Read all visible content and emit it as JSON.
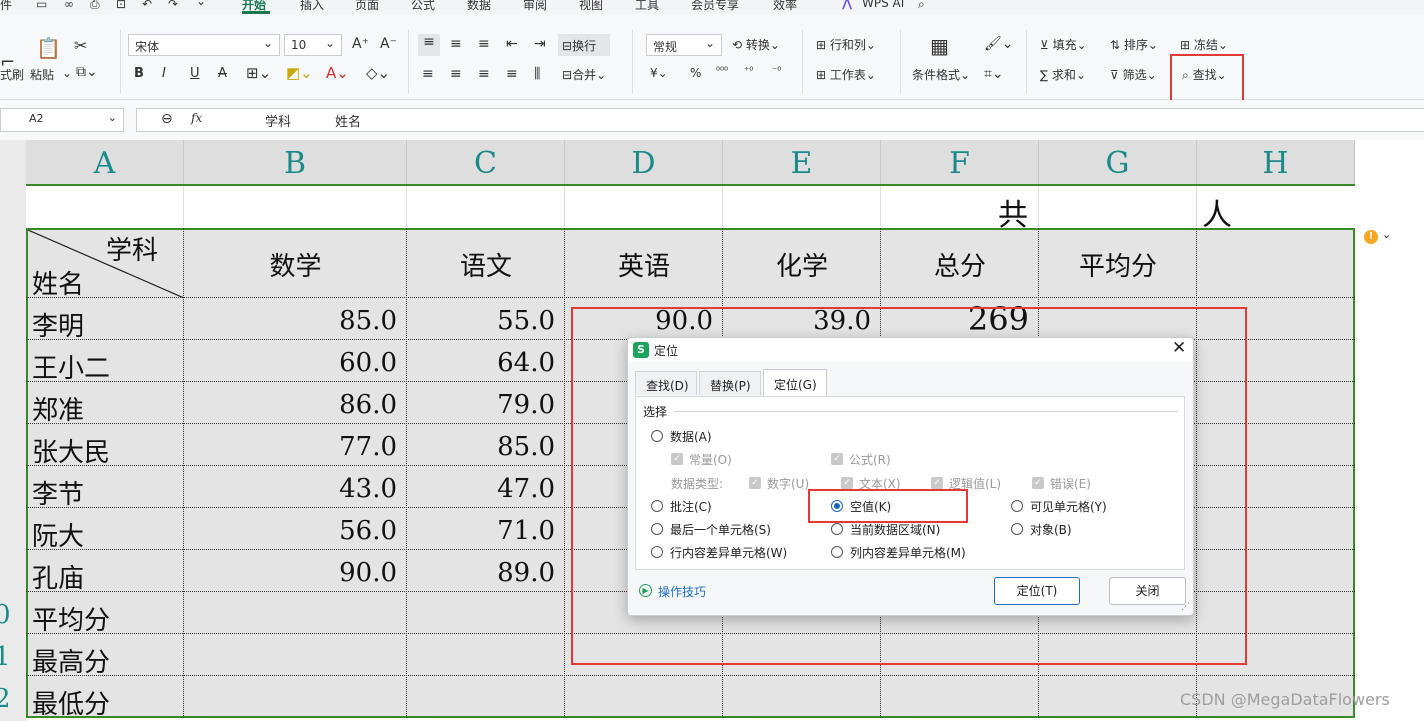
{
  "menu": {
    "items": [
      "件",
      "开始",
      "插入",
      "页面",
      "公式",
      "数据",
      "审阅",
      "视图",
      "工具",
      "会员专享",
      "效率"
    ],
    "wps_ai": "WPS AI"
  },
  "ribbon": {
    "format_painter": "式刷",
    "paste": "粘贴",
    "font_name": "宋体",
    "font_size": "10",
    "wrap": "换行",
    "number_format": "常规",
    "convert": "转换",
    "rows_cols": "行和列",
    "worksheet": "工作表",
    "cond_format": "条件格式",
    "merge": "合并",
    "fill": "填充",
    "sort": "排序",
    "freeze": "冻结",
    "sum": "求和",
    "filter": "筛选",
    "find": "查找",
    "currency": "¥",
    "percent": "%"
  },
  "formula_bar": {
    "cell_ref": "A2",
    "fx": "fx",
    "content_1": "学科",
    "content_2": "姓名"
  },
  "sheet": {
    "col_headers": [
      "A",
      "B",
      "C",
      "D",
      "E",
      "F",
      "G",
      "H"
    ],
    "row1": {
      "f": "共",
      "h": "人"
    },
    "header_row": {
      "diag_top": "学科",
      "diag_bottom": "姓名",
      "cols": [
        "数学",
        "语文",
        "英语",
        "化学",
        "总分",
        "平均分"
      ]
    },
    "rows": [
      {
        "name": "李明",
        "math": "85.0",
        "chinese": "55.0",
        "english": "90.0",
        "chem": "39.0",
        "total": "269"
      },
      {
        "name": "王小二",
        "math": "60.0",
        "chinese": "64.0"
      },
      {
        "name": "郑准",
        "math": "86.0",
        "chinese": "79.0"
      },
      {
        "name": "张大民",
        "math": "77.0",
        "chinese": "85.0"
      },
      {
        "name": "李节",
        "math": "43.0",
        "chinese": "47.0"
      },
      {
        "name": "阮大",
        "math": "56.0",
        "chinese": "71.0"
      },
      {
        "name": "孔庙",
        "math": "90.0",
        "chinese": "89.0"
      },
      {
        "name": "平均分"
      },
      {
        "name": "最高分"
      },
      {
        "name": "最低分"
      }
    ],
    "row_numbers": [
      "0",
      "1",
      "2"
    ]
  },
  "dialog": {
    "title": "定位",
    "tabs": [
      "查找(D)",
      "替换(P)",
      "定位(G)"
    ],
    "group": "选择",
    "opt_data": "数据(A)",
    "opt_const": "常量(O)",
    "opt_formula": "公式(R)",
    "data_type_label": "数据类型:",
    "opt_number": "数字(U)",
    "opt_text": "文本(X)",
    "opt_logic": "逻辑值(L)",
    "opt_error": "错误(E)",
    "opt_comment": "批注(C)",
    "opt_blank": "空值(K)",
    "opt_visible": "可见单元格(Y)",
    "opt_last": "最后一个单元格(S)",
    "opt_region": "当前数据区域(N)",
    "opt_object": "对象(B)",
    "opt_row_diff": "行内容差异单元格(W)",
    "opt_col_diff": "列内容差异单元格(M)",
    "tips": "操作技巧",
    "btn_locate": "定位(T)",
    "btn_close": "关闭"
  },
  "watermark": "CSDN @MegaDataFlowers",
  "colors": {
    "accent": "#1a7a4f",
    "highlight": "#e53935",
    "grid_border": "#3a8a2a"
  }
}
